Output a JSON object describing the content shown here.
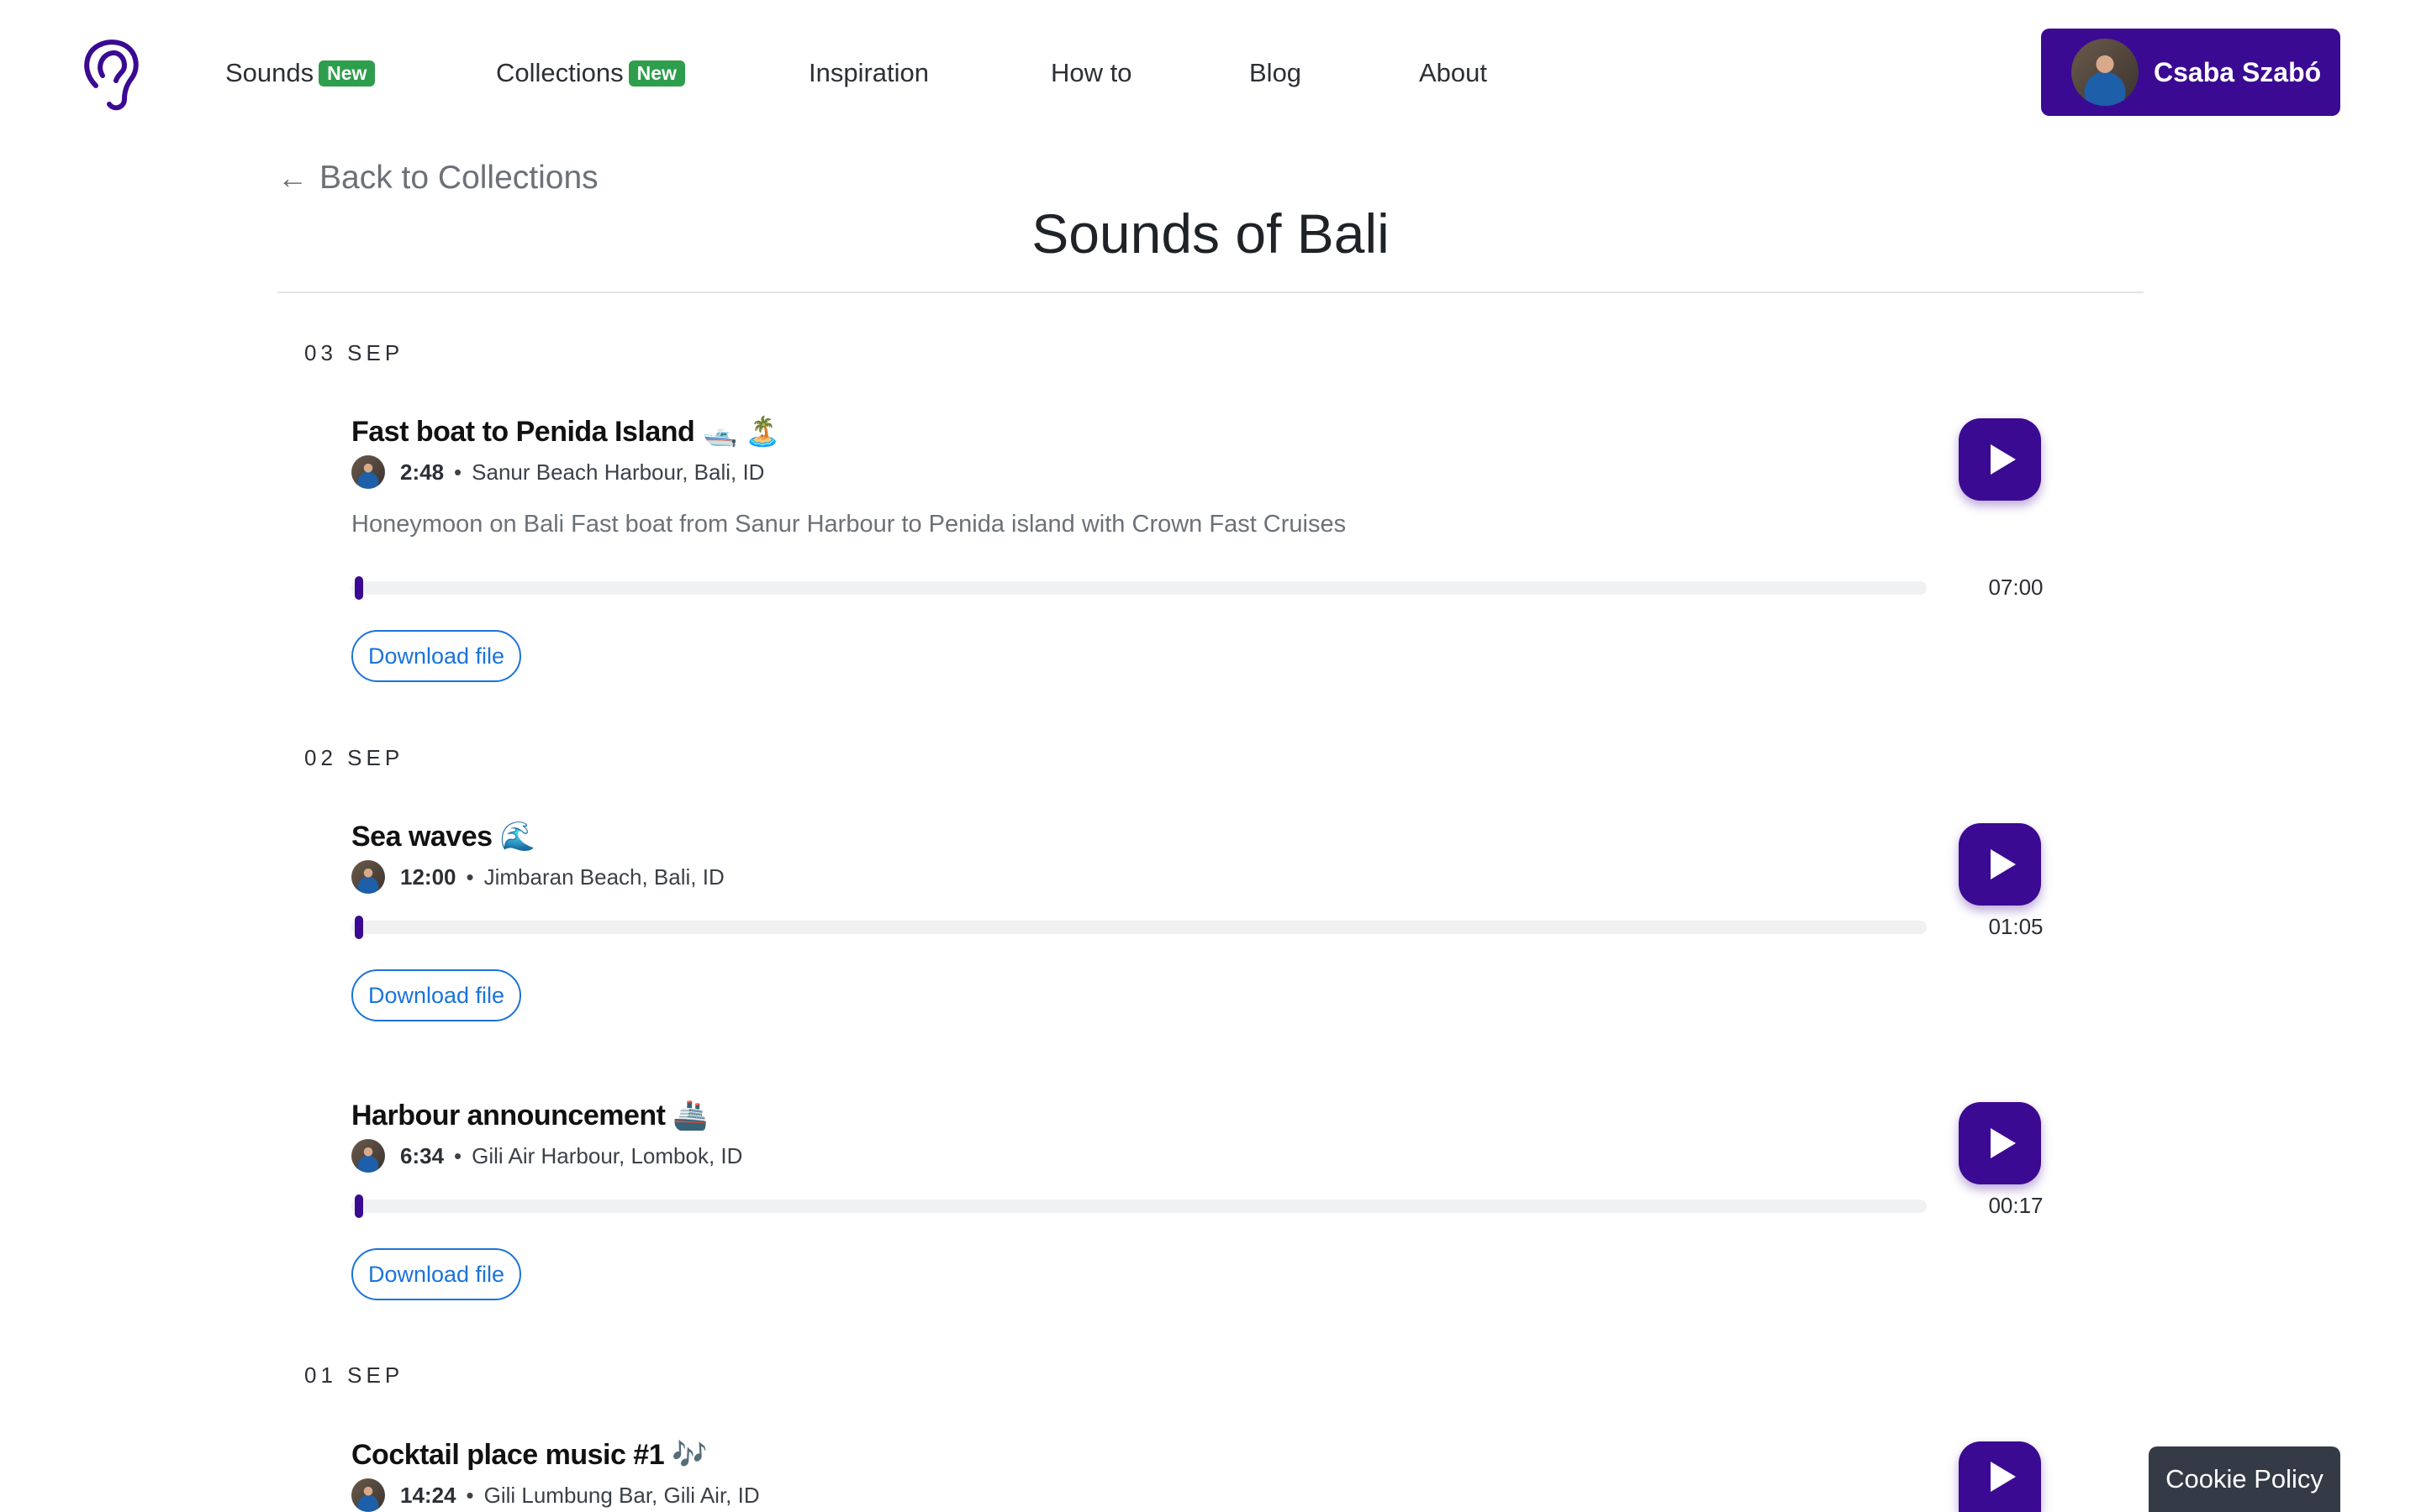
{
  "header": {
    "logo_icon": "ear-icon",
    "nav": [
      {
        "label": "Sounds",
        "badge": "New"
      },
      {
        "label": "Collections",
        "badge": "New"
      },
      {
        "label": "Inspiration"
      },
      {
        "label": "How to"
      },
      {
        "label": "Blog"
      },
      {
        "label": "About"
      }
    ],
    "user": {
      "name": "Csaba Szabó"
    }
  },
  "page": {
    "back_label": "Back to Collections",
    "title": "Sounds of Bali"
  },
  "groups": [
    {
      "date": "03 SEP",
      "entries": [
        {
          "title": "Fast boat to Penida Island 🛥️ 🏝️",
          "time": "2:48",
          "location": "Sanur Beach Harbour, Bali, ID",
          "description": "Honeymoon on Bali Fast boat from Sanur Harbour to Penida island with Crown Fast Cruises",
          "duration": "07:00",
          "progress": 0,
          "download_label": "Download file"
        }
      ]
    },
    {
      "date": "02 SEP",
      "entries": [
        {
          "title": "Sea waves 🌊",
          "time": "12:00",
          "location": "Jimbaran Beach, Bali, ID",
          "duration": "01:05",
          "progress": 0,
          "download_label": "Download file"
        },
        {
          "title": "Harbour announcement 🚢",
          "time": "6:34",
          "location": "Gili Air Harbour, Lombok, ID",
          "duration": "00:17",
          "progress": 0,
          "download_label": "Download file"
        }
      ]
    },
    {
      "date": "01 SEP",
      "entries": [
        {
          "title": "Cocktail place music #1 🎶",
          "time": "14:24",
          "location": "Gili Lumbung Bar, Gili Air, ID"
        }
      ]
    }
  ],
  "cookie": {
    "label": "Cookie Policy"
  },
  "colors": {
    "brand": "#3b0a92",
    "badge": "#2e9e4c",
    "link": "#1a73d9"
  }
}
